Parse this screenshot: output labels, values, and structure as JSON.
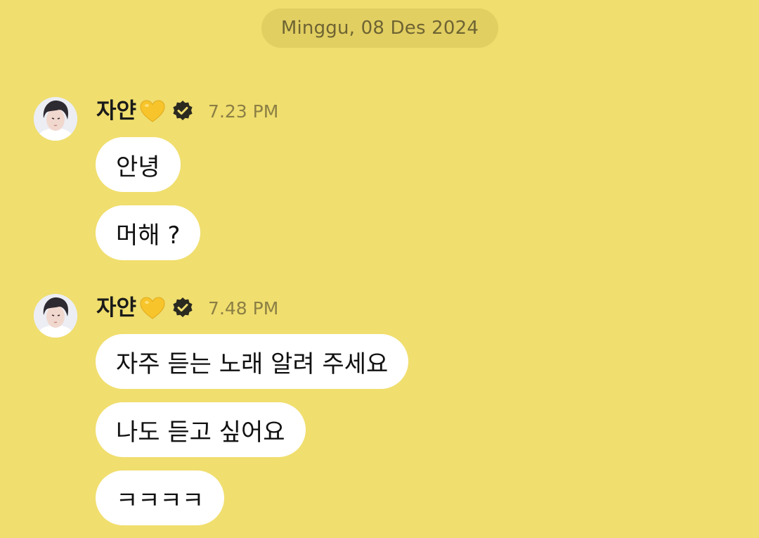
{
  "date_separator": "Minggu, 08 Des 2024",
  "groups": [
    {
      "sender": "자얀",
      "time": "7.23 PM",
      "messages": [
        "안녕",
        "머해 ?"
      ]
    },
    {
      "sender": "자얀",
      "time": "7.48 PM",
      "messages": [
        "자주 듣는 노래 알려 주세요",
        "나도 듣고 싶어요",
        "ㅋㅋㅋㅋ"
      ]
    }
  ],
  "icons": {
    "heart": "yellow-heart-icon",
    "verified": "verified-badge-icon"
  },
  "colors": {
    "background": "#F0DE6E",
    "bubble": "#FFFFFF",
    "date_pill": "#E2CF62",
    "heart": "#F7C52B",
    "badge": "#2B2A20"
  }
}
